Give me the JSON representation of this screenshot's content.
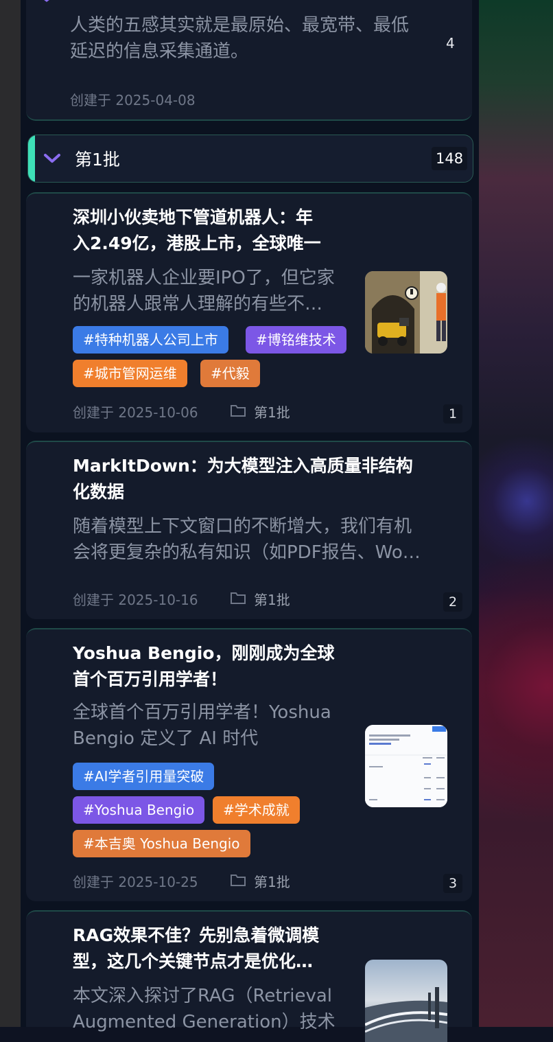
{
  "top_card": {
    "summary_lines": [
      "人类的五感其实就是最原始、最宽带、最低",
      "延迟的信息采集通道。"
    ],
    "date": "创建于 2025-04-08",
    "index": "4"
  },
  "group": {
    "title": "第1批",
    "count": "148"
  },
  "cards": [
    {
      "title_lines": [
        "深圳小伙卖地下管道机器人：年",
        "入2.49亿，港股上市，全球唯一"
      ],
      "summary_lines": [
        "一家机器人企业要IPO了，但它家",
        "的机器人跟常人理解的有些不…"
      ],
      "tags": [
        "#特种机器人公司上市",
        "#博铭维技术",
        "#城市管网运维",
        "#代毅"
      ],
      "date": "创建于 2025-10-06",
      "folder": "第1批",
      "index": "1"
    },
    {
      "title_lines": [
        "MarkItDown：为大模型注入高质量非结构",
        "化数据"
      ],
      "summary_lines": [
        "随着模型上下文窗口的不断增大，我们有机",
        "会将更复杂的私有知识（如PDF报告、Wo…"
      ],
      "date": "创建于 2025-10-16",
      "folder": "第1批",
      "index": "2"
    },
    {
      "title_lines": [
        "Yoshua Bengio，刚刚成为全球",
        "首个百万引用学者！"
      ],
      "summary_lines": [
        "全球首个百万引用学者！Yoshua",
        "Bengio 定义了 AI 时代"
      ],
      "tags": [
        "#AI学者引用量突破",
        "#Yoshua Bengio",
        "#学术成就",
        "#本吉奥 Yoshua Bengio"
      ],
      "date": "创建于 2025-10-25",
      "folder": "第1批",
      "index": "3"
    },
    {
      "title_lines": [
        "RAG效果不佳？先别急着微调模",
        "型，这几个关键节点才是优化…"
      ],
      "summary_lines": [
        "本文深入探讨了RAG（Retrieval",
        "Augmented Generation）技术"
      ]
    }
  ],
  "colors": {
    "accent_teal": "#3ee0b8",
    "chevron_purple": "#8a6cf0",
    "tag_blue": "#3b7be6",
    "tag_purple": "#7c57e6",
    "tag_orange": "#f07f2d"
  }
}
